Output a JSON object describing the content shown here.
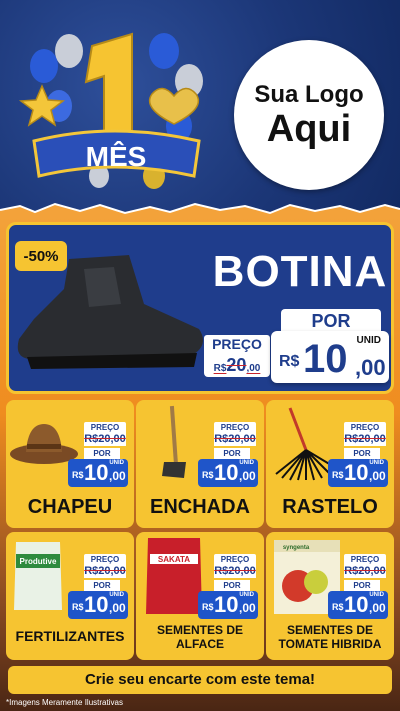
{
  "badge": {
    "number": "1",
    "label": "MÊS"
  },
  "logo": {
    "line1": "Sua Logo",
    "line2": "Aqui"
  },
  "hero": {
    "discount": "-50%",
    "title": "BOTINA",
    "preco_label": "PREÇO",
    "old_currency": "R$",
    "old_int": "20",
    "old_dec": ",00",
    "por_label": "POR",
    "unid": "UNID",
    "currency": "R$",
    "price_int": "10",
    "price_dec": ",00"
  },
  "products": [
    {
      "name": "CHAPEU",
      "preco": "PREÇO",
      "old": "R$20,00",
      "por": "POR",
      "unid": "UNID",
      "cur": "R$",
      "int": "10",
      "dec": ",00",
      "image": "hat"
    },
    {
      "name": "ENCHADA",
      "preco": "PREÇO",
      "old": "R$20,00",
      "por": "POR",
      "unid": "UNID",
      "cur": "R$",
      "int": "10",
      "dec": ",00",
      "image": "hoe"
    },
    {
      "name": "RASTELO",
      "preco": "PREÇO",
      "old": "R$20,00",
      "por": "POR",
      "unid": "UNID",
      "cur": "R$",
      "int": "10",
      "dec": ",00",
      "image": "rake"
    },
    {
      "name": "FERTILIZANTES",
      "preco": "PREÇO",
      "old": "R$20,00",
      "por": "POR",
      "unid": "UNID",
      "cur": "R$",
      "int": "10",
      "dec": ",00",
      "image": "fertilizer-bag",
      "bag_label": "Produtive"
    },
    {
      "name_line1": "SEMENTES DE",
      "name_line2": "ALFACE",
      "preco": "PREÇO",
      "old": "R$20,00",
      "por": "POR",
      "unid": "UNID",
      "cur": "R$",
      "int": "10",
      "dec": ",00",
      "image": "seed-pack",
      "pack_label": "SAKATA"
    },
    {
      "name_line1": "SEMENTES DE",
      "name_line2": "TOMATE HIBRIDA",
      "preco": "PREÇO",
      "old": "R$20,00",
      "por": "POR",
      "unid": "UNID",
      "cur": "R$",
      "int": "10",
      "dec": ",00",
      "image": "tomato-seed-pack",
      "pack_label": "syngenta"
    }
  ],
  "cta": "Crie seu encarte com este tema!",
  "note": "*Imagens Meramente Ilustrativas",
  "colors": {
    "navy": "#1f3d8c",
    "yellow": "#f6c431",
    "orange": "#ef8c1f",
    "price_blue": "#1f55c9",
    "strike_red": "#c8232c"
  }
}
